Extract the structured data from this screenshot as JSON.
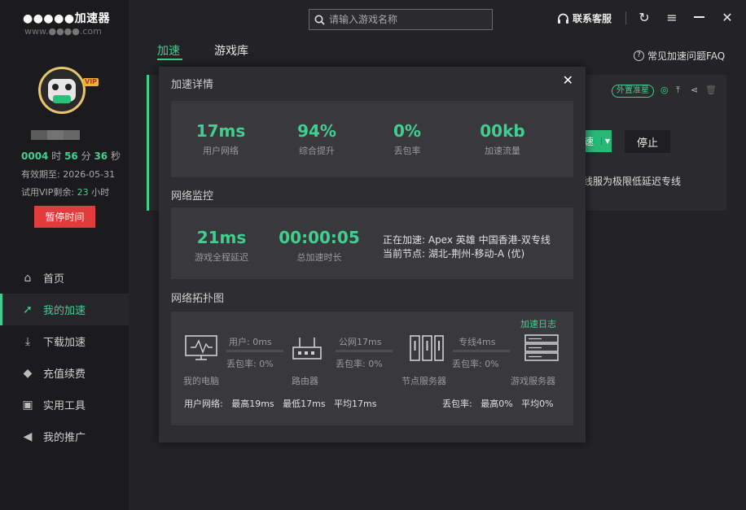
{
  "app": {
    "title": "●●●●●加速器",
    "subtitle": "www.●●●●.com"
  },
  "user": {
    "vip_badge": "VIP",
    "timer": {
      "hours": "0004",
      "h_unit": "时",
      "minutes": "56",
      "m_unit": "分",
      "seconds": "36",
      "s_unit": "秒"
    },
    "expire_label": "有效期至: 2026-05-31",
    "trial_prefix": "试用VIP剩余:",
    "trial_hours": "23",
    "trial_unit": "小时",
    "pause_label": "暂停时间"
  },
  "nav": [
    {
      "label": "首页",
      "icon": "home-icon"
    },
    {
      "label": "我的加速",
      "icon": "rocket-icon"
    },
    {
      "label": "下载加速",
      "icon": "download-icon"
    },
    {
      "label": "充值续费",
      "icon": "diamond-icon"
    },
    {
      "label": "实用工具",
      "icon": "toolbox-icon"
    },
    {
      "label": "我的推广",
      "icon": "megaphone-icon"
    }
  ],
  "search": {
    "placeholder": "请输入游戏名称"
  },
  "topbar": {
    "service_label": "联系客服"
  },
  "tabs": [
    {
      "label": "加速"
    },
    {
      "label": "游戏库"
    }
  ],
  "faq_label": "常见加速问题FAQ",
  "bg_card": {
    "tag": "外置准星",
    "start_label": "速",
    "stop_label": "停止",
    "line_text": "线服为极限低延迟专线"
  },
  "modal": {
    "title": "加速详情",
    "close": "✕",
    "stats": [
      {
        "value": "17ms",
        "label": "用户网络"
      },
      {
        "value": "94%",
        "label": "综合提升"
      },
      {
        "value": "0%",
        "label": "丢包率"
      },
      {
        "value": "00kb",
        "label": "加速流量"
      }
    ],
    "monitor_title": "网络监控",
    "monitor": {
      "latency_value": "21ms",
      "latency_label": "游戏全程延迟",
      "duration_value": "00:00:05",
      "duration_label": "总加速时长",
      "accelerating": "正在加速: Apex 英雄 中国香港-双专线",
      "node": "当前节点: 湖北-荆州-移动-A (优)"
    },
    "topo_title": "网络拓扑图",
    "topo": {
      "log_link": "加速日志",
      "devices": [
        "我的电脑",
        "路由器",
        "节点服务器",
        "游戏服务器"
      ],
      "links": [
        {
          "top": "用户: 0ms",
          "bottom": "丢包率: 0%"
        },
        {
          "top": "公网17ms",
          "bottom": "丢包率: 0%"
        },
        {
          "top": "专线4ms",
          "bottom": "丢包率: 0%"
        }
      ],
      "summary_left": "用户网络:   最高19ms   最低17ms   平均17ms",
      "summary_right": "丢包率:   最高0%   平均0%"
    }
  }
}
